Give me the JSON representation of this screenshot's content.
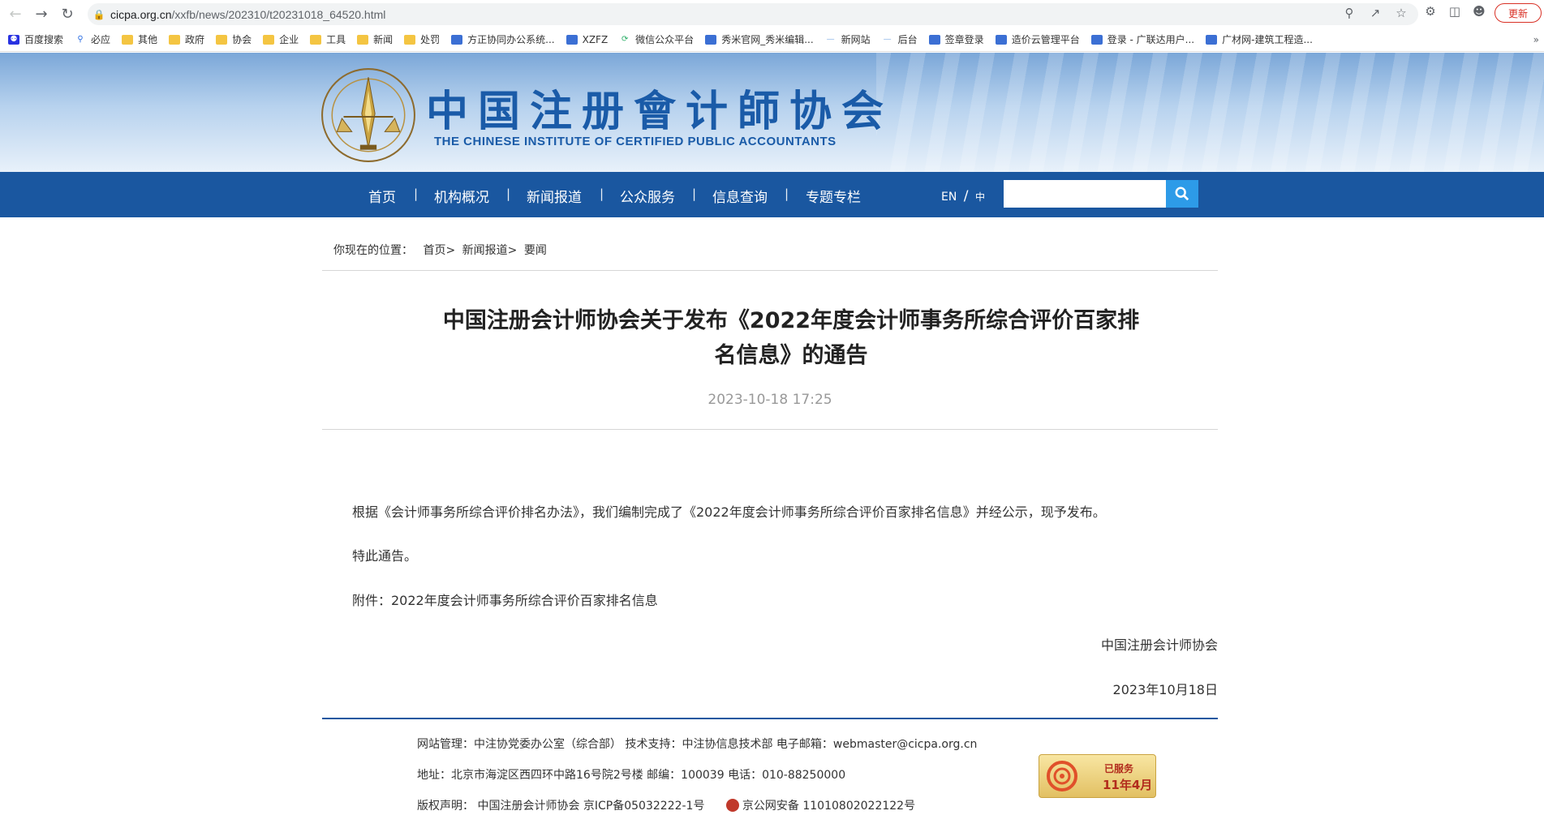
{
  "browser": {
    "url_domain": "cicpa.org.cn",
    "url_path": "/xxfb/news/202310/t20231018_64520.html",
    "update_label": "更新",
    "bookmarks": [
      {
        "label": "百度搜索",
        "icon": "baidu-icon"
      },
      {
        "label": "必应",
        "icon": "search-icon"
      },
      {
        "label": "其他",
        "icon": "folder-icon"
      },
      {
        "label": "政府",
        "icon": "folder-icon"
      },
      {
        "label": "协会",
        "icon": "folder-icon"
      },
      {
        "label": "企业",
        "icon": "folder-icon"
      },
      {
        "label": "工具",
        "icon": "folder-icon"
      },
      {
        "label": "新闻",
        "icon": "folder-icon"
      },
      {
        "label": "处罚",
        "icon": "folder-icon"
      },
      {
        "label": "方正协同办公系统...",
        "icon": "app-icon"
      },
      {
        "label": "XZFZ",
        "icon": "app-icon"
      },
      {
        "label": "微信公众平台",
        "icon": "wechat-icon"
      },
      {
        "label": "秀米官网_秀米编辑...",
        "icon": "app-icon"
      },
      {
        "label": "新网站",
        "icon": "web-icon"
      },
      {
        "label": "后台",
        "icon": "web-icon"
      },
      {
        "label": "签章登录",
        "icon": "app-icon"
      },
      {
        "label": "造价云管理平台",
        "icon": "app-icon"
      },
      {
        "label": "登录 - 广联达用户...",
        "icon": "app-icon"
      },
      {
        "label": "广材网-建筑工程造...",
        "icon": "app-icon"
      }
    ]
  },
  "site": {
    "title": "中国注册會计師协会",
    "subtitle": "THE CHINESE INSTITUTE OF CERTIFIED PUBLIC ACCOUNTANTS",
    "nav": [
      "首页",
      "机构概况",
      "新闻报道",
      "公众服务",
      "信息查询",
      "专题专栏"
    ],
    "lang_en": "EN",
    "lang_sep": "/",
    "lang_zh": "中",
    "search_placeholder": ""
  },
  "breadcrumb": {
    "prefix": "你现在的位置：",
    "items": [
      "首页",
      "新闻报道",
      "要闻"
    ],
    "sep": ">"
  },
  "article": {
    "title": "中国注册会计师协会关于发布《2022年度会计师事务所综合评价百家排名信息》的通告",
    "date": "2023-10-18 17:25",
    "paragraphs": [
      "根据《会计师事务所综合评价排名办法》，我们编制完成了《2022年度会计师事务所综合评价百家排名信息》并经公示，现予发布。",
      "特此通告。",
      "附件：2022年度会计师事务所综合评价百家排名信息"
    ],
    "signature": "中国注册会计师协会",
    "sign_date": "2023年10月18日"
  },
  "footer": {
    "line1": "网站管理：中注协党委办公室（综合部）    技术支持：中注协信息技术部    电子邮箱：webmaster@cicpa.org.cn",
    "line2": "地址：北京市海淀区西四环中路16号院2号楼    邮编：100039    电话：010-88250000",
    "copyright": "版权声明： 中国注册会计师协会    京ICP备05032222-1号",
    "police": "京公网安备 11010802022122号",
    "badge_top": "已服务",
    "badge_bottom": "11年4月"
  },
  "colors": {
    "nav_bg": "#1a57a0",
    "title_blue": "#1a5ba8",
    "search_btn": "#2d9be8"
  }
}
